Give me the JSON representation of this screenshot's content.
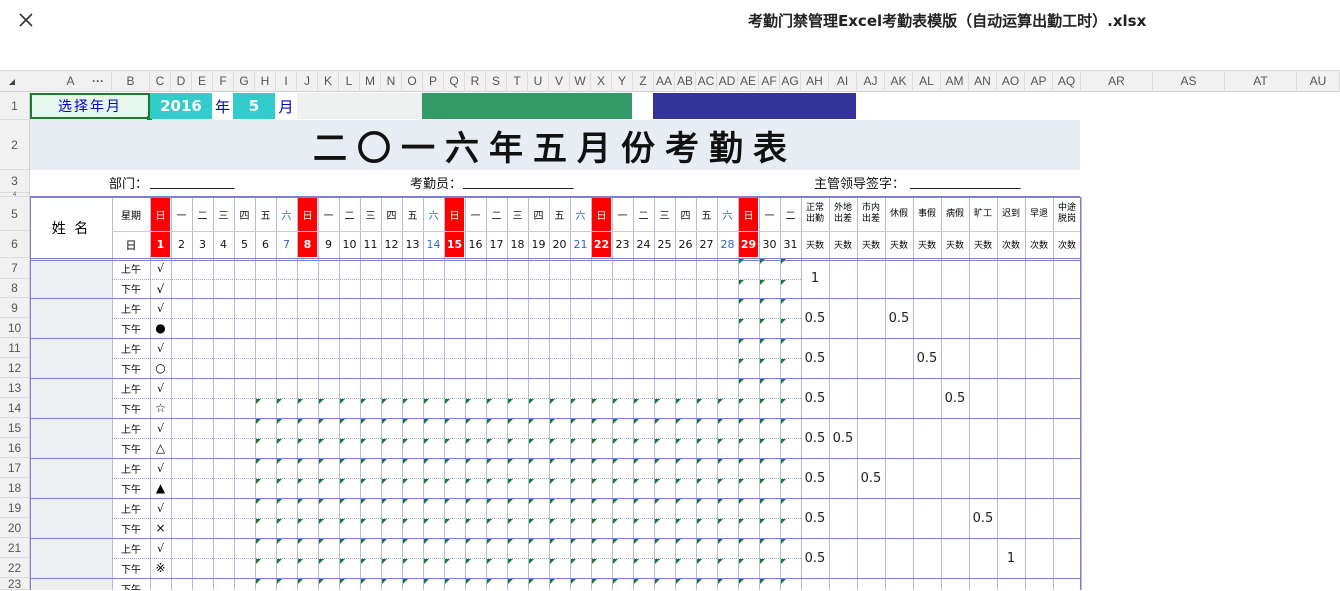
{
  "app": {
    "close_icon": "close-icon",
    "file_title": "考勤门禁管理Excel考勤表模版（自动运算出勤工时）.xlsx"
  },
  "columns": [
    "A",
    "B",
    "C",
    "D",
    "E",
    "F",
    "G",
    "H",
    "I",
    "J",
    "K",
    "L",
    "M",
    "N",
    "O",
    "P",
    "Q",
    "R",
    "S",
    "T",
    "U",
    "V",
    "W",
    "X",
    "Y",
    "Z",
    "AA",
    "AB",
    "AC",
    "AD",
    "AE",
    "AF",
    "AG",
    "AH",
    "AI",
    "AJ",
    "AK",
    "AL",
    "AM",
    "AN",
    "AO",
    "AP",
    "AQ",
    "AR",
    "AS",
    "AT",
    "AU"
  ],
  "col_header_more": "···",
  "rows": [
    "1",
    "2",
    "3",
    "4",
    "5",
    "6",
    "7",
    "8",
    "9",
    "10",
    "11",
    "12",
    "13",
    "14",
    "15",
    "16",
    "17",
    "18",
    "19",
    "20",
    "21",
    "22",
    "23"
  ],
  "row1": {
    "select_label": "选择年月",
    "year_value": "2016",
    "year_unit": "年",
    "month_value": "5",
    "month_unit": "月",
    "colors": {
      "select_bg": "#e6f7ee",
      "value_bg": "#33cccc",
      "green_block": "#339966",
      "blue_block": "#333399"
    }
  },
  "title": "二〇一六年五月份考勤表",
  "info": {
    "dept_label": "部门：",
    "dept_line": "_____________",
    "clerk_label": "考勤员：",
    "clerk_line": "_________________",
    "manager_label": "主管领导签字：",
    "manager_line": "_________________"
  },
  "header": {
    "name_label": "姓 名",
    "weekday_label": "星期",
    "day_label": "日",
    "weekdays": [
      "日",
      "一",
      "二",
      "三",
      "四",
      "五",
      "六",
      "日",
      "一",
      "二",
      "三",
      "四",
      "五",
      "六",
      "日",
      "一",
      "二",
      "三",
      "四",
      "五",
      "六",
      "日",
      "一",
      "二",
      "三",
      "四",
      "五",
      "六",
      "日",
      "一",
      "二"
    ],
    "days": [
      "1",
      "2",
      "3",
      "4",
      "5",
      "6",
      "7",
      "8",
      "9",
      "10",
      "11",
      "12",
      "13",
      "14",
      "15",
      "16",
      "17",
      "18",
      "19",
      "20",
      "21",
      "22",
      "23",
      "24",
      "25",
      "26",
      "27",
      "28",
      "29",
      "30",
      "31"
    ],
    "stats": [
      {
        "name": "正常出勤",
        "unit": "天数"
      },
      {
        "name": "外地出差",
        "unit": "天数"
      },
      {
        "name": "市内出差",
        "unit": "天数"
      },
      {
        "name": "休假",
        "unit": "天数"
      },
      {
        "name": "事假",
        "unit": "天数"
      },
      {
        "name": "病假",
        "unit": "天数"
      },
      {
        "name": "旷工",
        "unit": "天数"
      },
      {
        "name": "迟到",
        "unit": "次数"
      },
      {
        "name": "早退",
        "unit": "次数"
      },
      {
        "name": "中途脱岗",
        "unit": "次数"
      }
    ],
    "colors": {
      "sunday": "#ff0000",
      "saturday": "#3366cc"
    }
  },
  "am_label": "上午",
  "pm_label": "下午",
  "employees": [
    {
      "am_mark": "√",
      "pm_mark": "√",
      "stats": [
        "1",
        "",
        "",
        "",
        "",
        "",
        "",
        "",
        "",
        ""
      ]
    },
    {
      "am_mark": "√",
      "pm_mark": "●",
      "stats": [
        "0.5",
        "",
        "",
        "0.5",
        "",
        "",
        "",
        "",
        "",
        ""
      ]
    },
    {
      "am_mark": "√",
      "pm_mark": "○",
      "stats": [
        "0.5",
        "",
        "",
        "",
        "0.5",
        "",
        "",
        "",
        "",
        ""
      ]
    },
    {
      "am_mark": "√",
      "pm_mark": "☆",
      "stats": [
        "0.5",
        "",
        "",
        "",
        "",
        "0.5",
        "",
        "",
        "",
        ""
      ]
    },
    {
      "am_mark": "√",
      "pm_mark": "△",
      "stats": [
        "0.5",
        "0.5",
        "",
        "",
        "",
        "",
        "",
        "",
        "",
        ""
      ]
    },
    {
      "am_mark": "√",
      "pm_mark": "▲",
      "stats": [
        "0.5",
        "",
        "0.5",
        "",
        "",
        "",
        "",
        "",
        "",
        ""
      ]
    },
    {
      "am_mark": "√",
      "pm_mark": "×",
      "stats": [
        "0.5",
        "",
        "",
        "",
        "",
        "",
        "0.5",
        "",
        "",
        ""
      ]
    },
    {
      "am_mark": "√",
      "pm_mark": "※",
      "stats": [
        "0.5",
        "",
        "",
        "",
        "",
        "",
        "",
        "1",
        "",
        ""
      ]
    },
    {
      "am_mark": "√",
      "pm_mark": "",
      "stats": [
        "",
        "",
        "",
        "",
        "",
        "",
        "",
        "",
        "",
        ""
      ]
    }
  ]
}
